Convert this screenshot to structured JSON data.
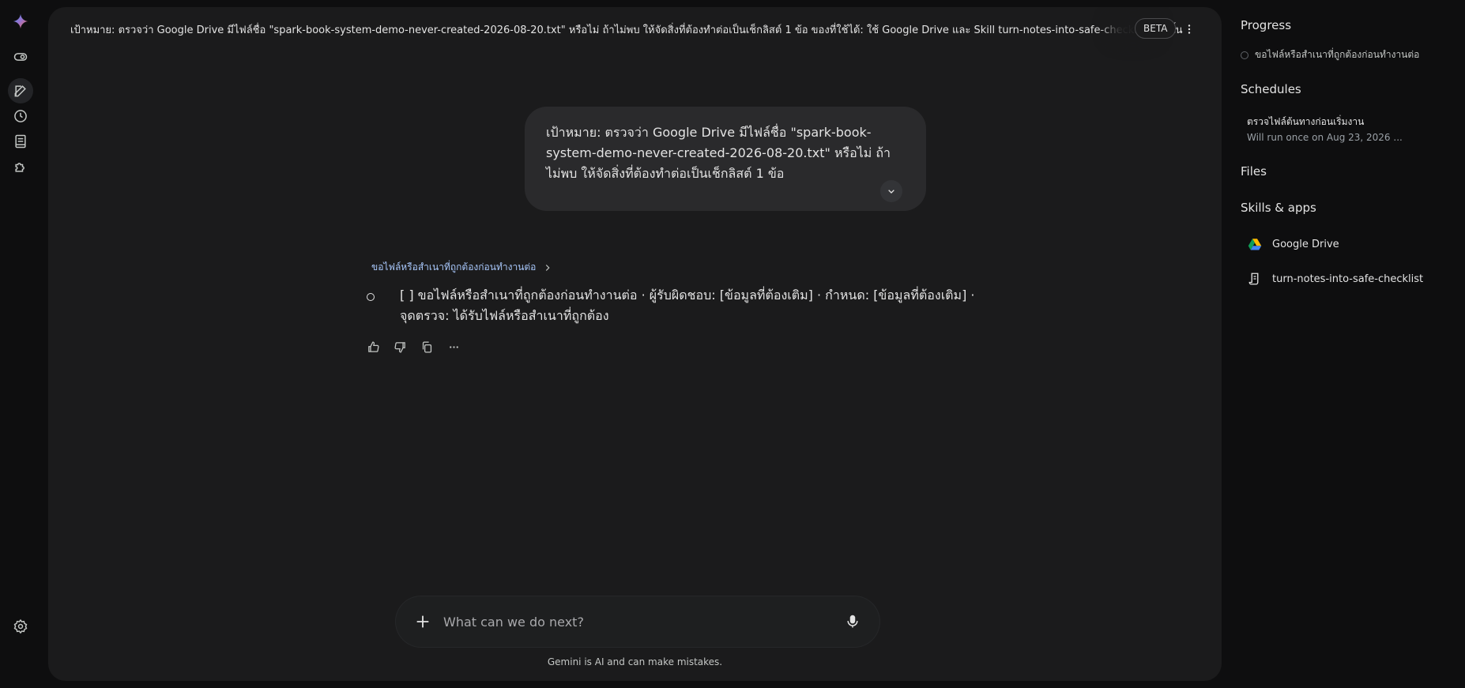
{
  "main": {
    "title": "เป้าหมาย: ตรวจว่า Google Drive มีไฟล์ชื่อ \"spark-book-system-demo-never-created-2026-08-20.txt\" หรือไม่ ถ้าไม่พบ ให้จัดสิ่งที่ต้องทำต่อเป็นเช็กลิสต์ 1 ข้อ ของที่ใช้ได้: ใช้ Google Drive และ Skill turn-notes-into-safe-checklist เท่านั้น ไม่ใช้ Gma...",
    "beta_label": "BETA",
    "user_message": "เป้าหมาย: ตรวจว่า Google Drive มีไฟล์ชื่อ \"spark-book-system-demo-never-created-2026-08-20.txt\" หรือไม่ ถ้าไม่พบ ให้จัดสิ่งที่ต้องทำต่อเป็นเช็กลิสต์ 1 ข้อ",
    "thought_label": "ขอไฟล์หรือสำเนาที่ถูกต้องก่อนทำงานต่อ",
    "response": "[ ] ขอไฟล์หรือสำเนาที่ถูกต้องก่อนทำงานต่อ · ผู้รับผิดชอบ: [ข้อมูลที่ต้องเติม] · กำหนด: [ข้อมูลที่ต้องเติม] · จุดตรวจ: ได้รับไฟล์หรือสำเนาที่ถูกต้อง",
    "composer_placeholder": "What can we do next?",
    "disclaimer": "Gemini is AI and can make mistakes."
  },
  "side": {
    "progress_heading": "Progress",
    "progress_item": "ขอไฟล์หรือสำเนาที่ถูกต้องก่อนทำงานต่อ",
    "schedules_heading": "Schedules",
    "schedule_title": "ตรวจไฟล์ต้นทางก่อนเริ่มงาน",
    "schedule_sub": "Will run once on Aug 23, 2026 ...",
    "files_heading": "Files",
    "skills_heading": "Skills & apps",
    "apps": [
      {
        "label": "Google Drive",
        "icon": "google-drive-icon"
      },
      {
        "label": "turn-notes-into-safe-checklist",
        "icon": "skill-scroll-icon"
      }
    ]
  },
  "rail": {
    "icons": [
      "gemini-spark-icon",
      "toggle-icon",
      "new-chat-icon",
      "history-icon",
      "library-icon",
      "extensions-icon",
      "settings-icon"
    ]
  },
  "colors": {
    "background": "#0e0e0f",
    "panel": "#1b1b1c",
    "bubble": "#2a2a2c",
    "link_accent": "#a8c7fa",
    "text": "#e3e3e3"
  }
}
